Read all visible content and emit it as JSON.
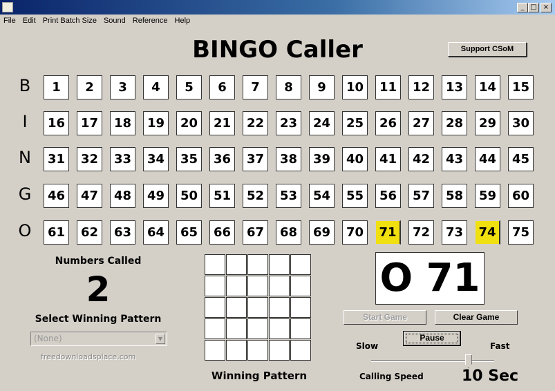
{
  "window": {
    "title": "",
    "controls": [
      "_",
      "□",
      "×"
    ]
  },
  "menu": [
    "File",
    "Edit",
    "Print Batch Size",
    "Sound",
    "Reference",
    "Help"
  ],
  "title": "BINGO Caller",
  "support_button": "Support CSoM",
  "letters": [
    "B",
    "I",
    "N",
    "G",
    "O"
  ],
  "called_numbers": [
    71,
    74
  ],
  "called_color": "#f0e010",
  "numbers_called_label": "Numbers Called",
  "numbers_called_count": "2",
  "select_pattern_label": "Select Winning Pattern",
  "pattern_select": {
    "value": "(None)"
  },
  "watermark": "freedownloadsplace.com",
  "winning_pattern_label": "Winning Pattern",
  "current_call": "O 71",
  "buttons": {
    "start": "Start Game",
    "clear": "Clear Game",
    "pause": "Pause"
  },
  "speed": {
    "slow": "Slow",
    "fast": "Fast",
    "label": "Calling Speed",
    "value_text": "10 Sec",
    "slider_fraction": 0.79
  }
}
